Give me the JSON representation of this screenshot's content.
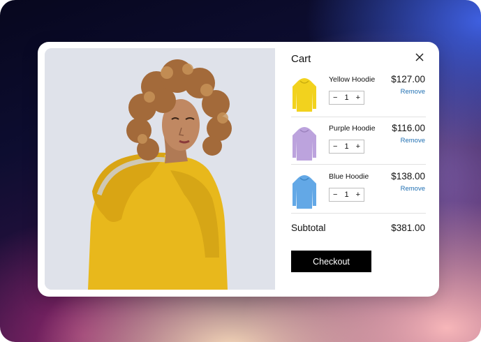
{
  "cart": {
    "title": "Cart",
    "close_icon": "close-icon",
    "items": [
      {
        "name": "Yellow Hoodie",
        "price": "$127.00",
        "quantity": "1",
        "decrement": "−",
        "increment": "+",
        "remove_label": "Remove",
        "color": "#F2D21E"
      },
      {
        "name": "Purple Hoodie",
        "price": "$116.00",
        "quantity": "1",
        "decrement": "−",
        "increment": "+",
        "remove_label": "Remove",
        "color": "#BCA3DD"
      },
      {
        "name": "Blue Hoodie",
        "price": "$138.00",
        "quantity": "1",
        "decrement": "−",
        "increment": "+",
        "remove_label": "Remove",
        "color": "#63A8E6"
      }
    ],
    "subtotal_label": "Subtotal",
    "subtotal_value": "$381.00",
    "checkout_label": "Checkout"
  },
  "colors": {
    "accent_link": "#1F6FB2",
    "checkout_bg": "#000000",
    "hero_hoodie": "#E8B81C"
  }
}
